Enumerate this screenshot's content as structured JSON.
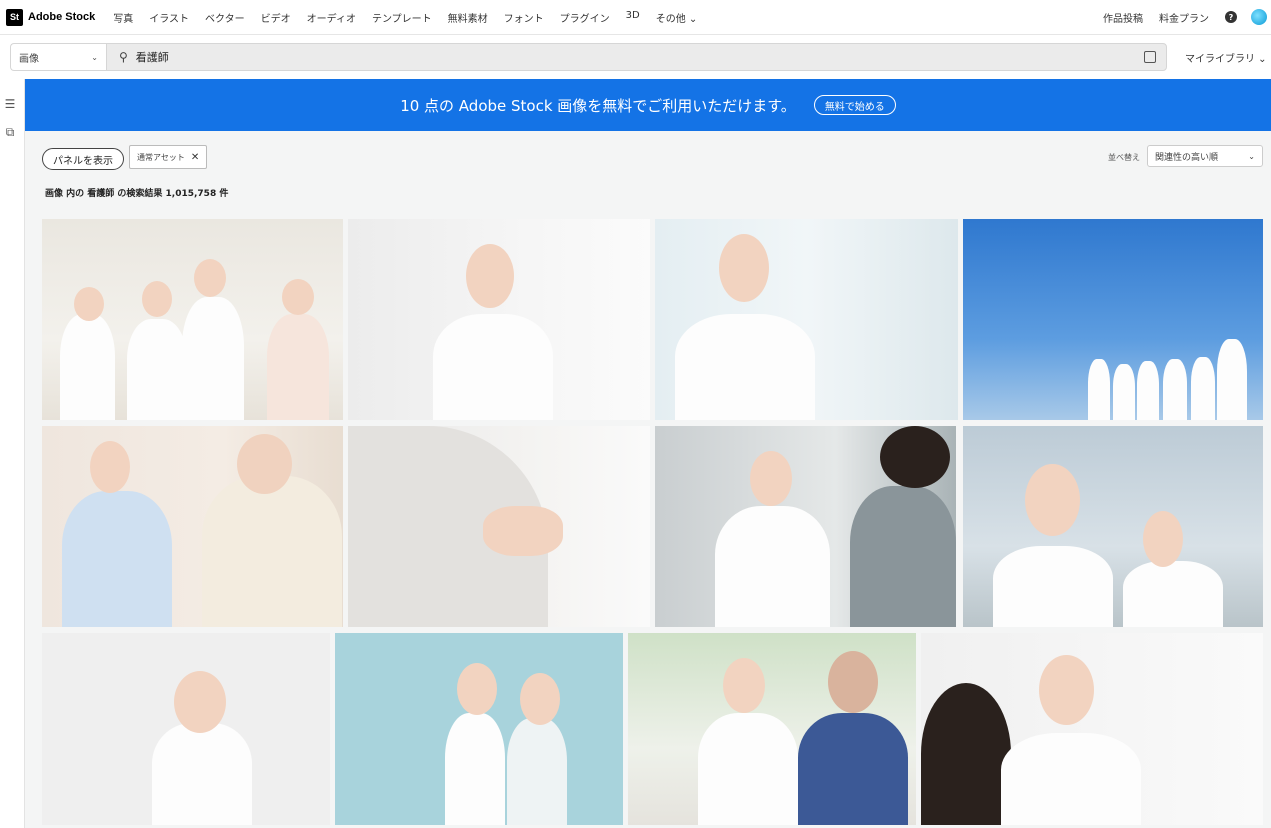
{
  "brand": {
    "mark": "St",
    "name": "Adobe Stock"
  },
  "nav": {
    "links": [
      "写真",
      "イラスト",
      "ベクター",
      "ビデオ",
      "オーディオ",
      "テンプレート",
      "無料素材",
      "フォント",
      "プラグイン",
      "3D",
      "その他 ⌄"
    ],
    "contribute": "作品投稿",
    "pricing": "料金プラン",
    "help": "?"
  },
  "search": {
    "type_value": "画像",
    "query": "看護師",
    "my_library": "マイライブラリ ⌄"
  },
  "banner": {
    "text": "10 点の Adobe Stock 画像を無料でご利用いただけます。",
    "button": "無料で始める"
  },
  "filters": {
    "panel_button": "パネルを表示",
    "chip_label": "通常アセット",
    "chip_close": "✕",
    "sort_label": "並べ替え",
    "sort_value": "関連性の高い順"
  },
  "results": {
    "summary": "画像 内の 看護師 の検索結果 1,015,758 件"
  },
  "colors": {
    "banner": "#1473e6",
    "avatar": "#0a9ad6"
  },
  "icons": {
    "search": "search-icon",
    "visual_search": "visual-search-icon",
    "filters": "filters-icon",
    "rail_visual": "visual-search-icon"
  }
}
